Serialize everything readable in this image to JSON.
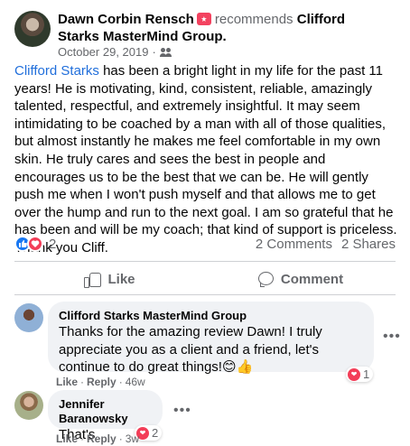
{
  "post": {
    "author": "Dawn Corbin Rensch",
    "recommends_text": "recommends",
    "page_name": "Clifford Starks MasterMind Group.",
    "date": "October 29, 2019",
    "dot": "·",
    "text_tag": "Clifford Starks",
    "text_body": " has been a bright light in my life for the past 11 years! He is motivating, kind, consistent, reliable, amazingly talented, respectful, and extremely insightful. It may seem intimidating to be coached by a man with all of those qualities, but almost instantly he makes me feel comfortable in my own skin. He truly cares and sees the best in people and encourages us to be the best that we can be. He will gently push me when I won't push myself and that allows me to get over the hump and run to the next goal. I am so grateful that he has been and will be my coach; that kind of support is priceless. Thank you Cliff."
  },
  "stats": {
    "reaction_count": "2",
    "comments": "2 Comments",
    "shares": "2 Shares"
  },
  "actions": {
    "like": "Like",
    "comment": "Comment"
  },
  "comments": [
    {
      "name": "Clifford Starks MasterMind Group",
      "text": "Thanks for the amazing review Dawn! I truly appreciate you as a client and a friend, let's continue to do great things!😊👍",
      "reaction_count": "1",
      "like": "Like",
      "reply": "Reply",
      "time": "46w"
    },
    {
      "name": "Jennifer Baranowsky",
      "text": "That's accurate!",
      "reaction_count": "2",
      "like": "Like",
      "reply": "Reply",
      "time": "3w"
    }
  ],
  "colors": {
    "tag_blue": "#216fdb",
    "like_blue": "#1877f2",
    "love_red": "#f33e58",
    "secondary_text": "#65676b"
  },
  "icons": {
    "recommend": "recommend-icon",
    "audience": "friends-icon",
    "like_reaction": "like-reaction-icon",
    "love_reaction": "love-reaction-icon",
    "like": "thumbs-up-icon",
    "comment": "comment-icon",
    "more": "more-options-icon"
  }
}
